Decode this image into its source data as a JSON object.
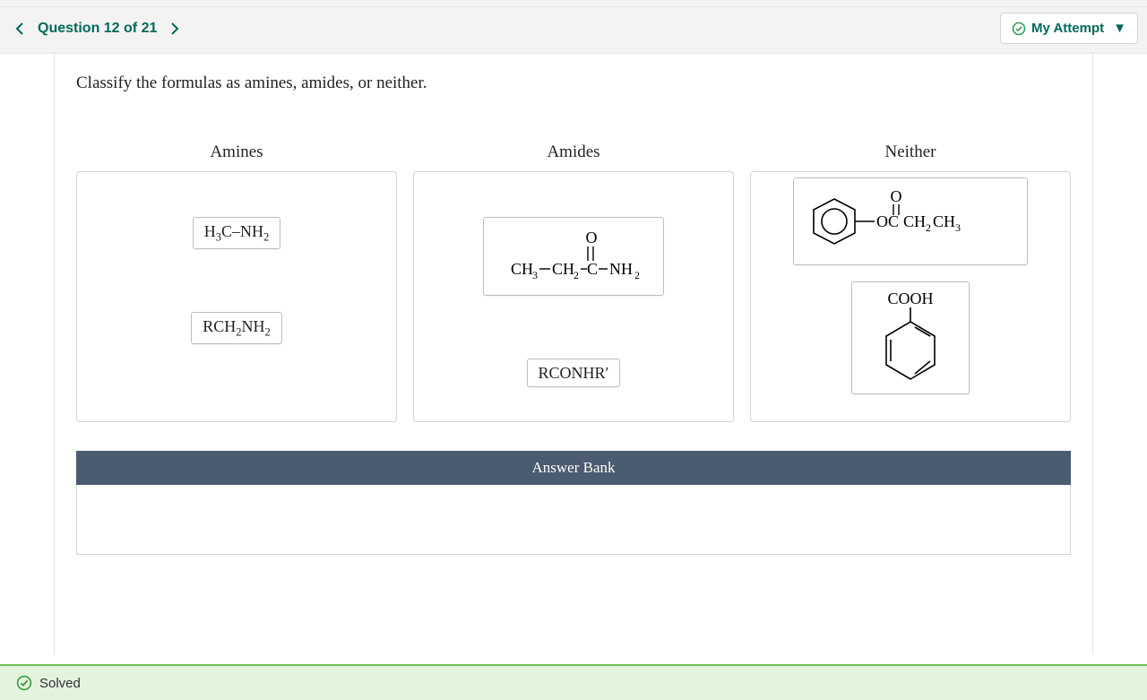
{
  "nav": {
    "prev_label": "Previous question",
    "next_label": "Next question",
    "question_counter": "Question 12 of 21",
    "attempt_label": "My Attempt"
  },
  "prompt": "Classify the formulas as amines, amides, or neither.",
  "columns": {
    "amines": {
      "title": "Amines",
      "items": [
        "H3C-NH2",
        "RCH2NH2"
      ]
    },
    "amides": {
      "title": "Amides",
      "items": [
        "CH3-CH2-C(=O)-NH2",
        "RCONHR'"
      ]
    },
    "neither": {
      "title": "Neither",
      "items": [
        "phenyl-OC(=O)CH2CH3",
        "benzoic-acid-COOH"
      ]
    }
  },
  "answer_bank_label": "Answer Bank",
  "status": "Solved"
}
